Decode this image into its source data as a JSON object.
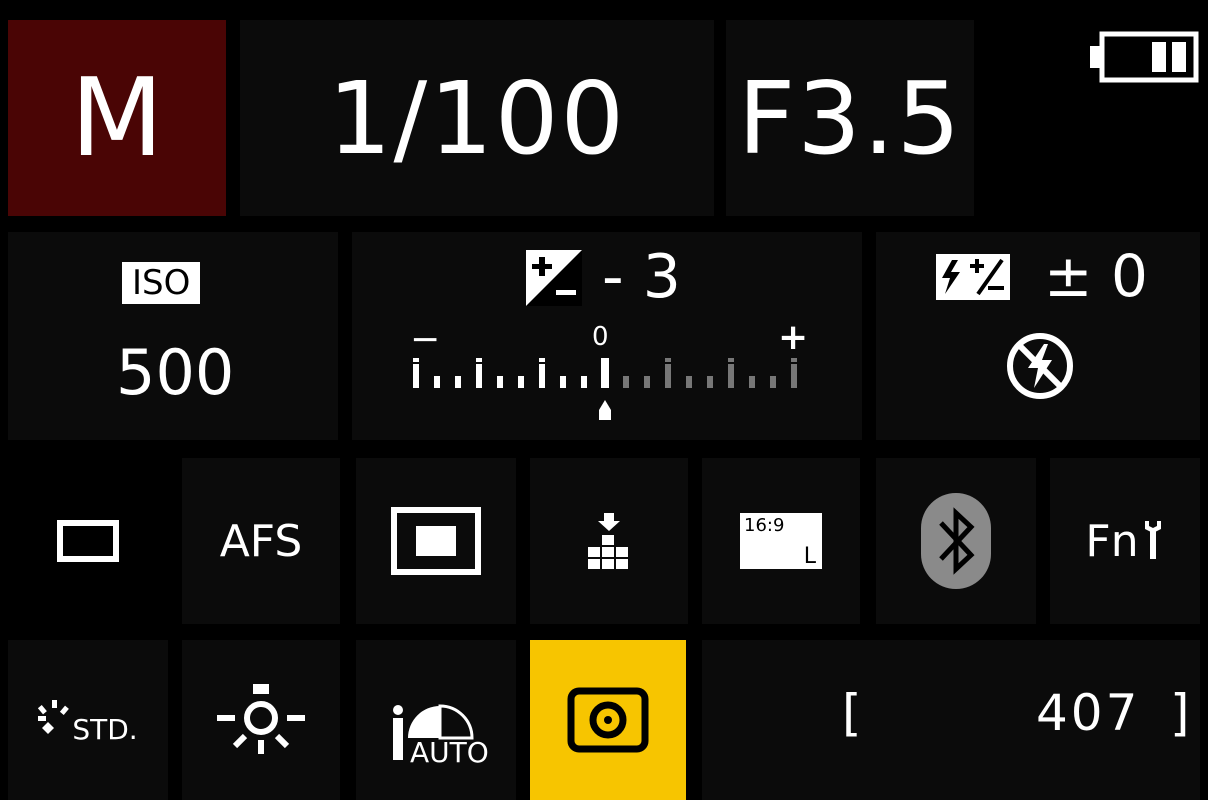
{
  "header": {
    "mode": "M",
    "shutter_speed": "1/100",
    "aperture": "F3.5",
    "battery_icon": "battery-icon"
  },
  "exposure": {
    "iso_label": "ISO",
    "iso_value": "500",
    "exposure_comp_value": "- 3",
    "meter": {
      "minus_label": "−",
      "zero_label": "0",
      "plus_label": "+",
      "value_stops": -3
    },
    "flash_comp_value": "± 0",
    "flash_icon": "flash-off-icon"
  },
  "settings_row": {
    "drive": "single-shot-icon",
    "focus_mode": "AFS",
    "af_area": "af-area-icon",
    "quality": "quality-icon",
    "aspect_ratio": "16:9",
    "picture_size": "L",
    "bluetooth": "bluetooth-icon",
    "fn_label": "Fn"
  },
  "bottom_row": {
    "photo_style": "STD.",
    "white_balance": "white-balance-icon",
    "i_dynamic_label": "AUTO",
    "metering": "metering-icon",
    "shots_open": "[",
    "shots_remaining": "407",
    "shots_close": "]"
  },
  "colors": {
    "mode_bg": "#4a0505",
    "selected_bg": "#f7c500",
    "tile_bg": "#0b0b0b",
    "bluetooth_bg": "#8a8a8a"
  }
}
